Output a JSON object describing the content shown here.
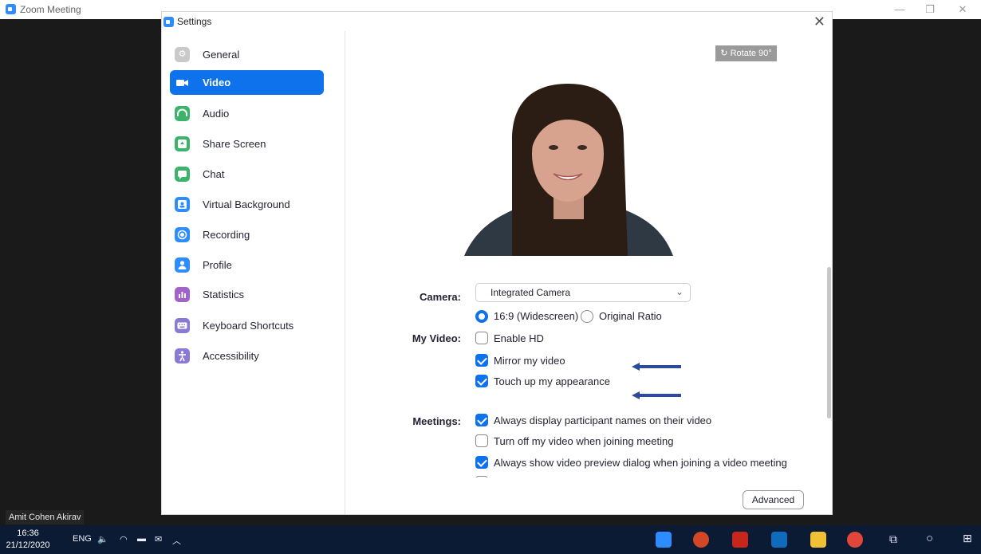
{
  "zoom_window": {
    "title": "Zoom Meeting"
  },
  "dialog": {
    "title": "Settings"
  },
  "sidebar": {
    "items": [
      {
        "label": "General",
        "icon": "gear-icon",
        "color": "#c9c9c9"
      },
      {
        "label": "Video",
        "icon": "video-camera-icon",
        "color": "#0e72ed",
        "active": true
      },
      {
        "label": "Audio",
        "icon": "headphones-icon",
        "color": "#3bb36b"
      },
      {
        "label": "Share Screen",
        "icon": "share-screen-icon",
        "color": "#3bb36b"
      },
      {
        "label": "Chat",
        "icon": "chat-icon",
        "color": "#3bb36b"
      },
      {
        "label": "Virtual Background",
        "icon": "person-background-icon",
        "color": "#2d8cff"
      },
      {
        "label": "Recording",
        "icon": "record-icon",
        "color": "#2d8cff"
      },
      {
        "label": "Profile",
        "icon": "person-icon",
        "color": "#2d8cff"
      },
      {
        "label": "Statistics",
        "icon": "bar-chart-icon",
        "color": "#a162c9"
      },
      {
        "label": "Keyboard Shortcuts",
        "icon": "keyboard-icon",
        "color": "#8a7ad4"
      },
      {
        "label": "Accessibility",
        "icon": "accessibility-icon",
        "color": "#8a7ad4"
      }
    ]
  },
  "video": {
    "rotate_label": "Rotate 90°",
    "camera_label": "Camera:",
    "camera_value": "Integrated Camera",
    "ratio_options": [
      {
        "label": "16:9 (Widescreen)",
        "selected": true
      },
      {
        "label": "Original Ratio",
        "selected": false
      }
    ],
    "my_video_label": "My Video:",
    "my_video_options": [
      {
        "label": "Enable HD",
        "checked": false
      },
      {
        "label": "Mirror my video",
        "checked": true
      },
      {
        "label": "Touch up my appearance",
        "checked": true
      }
    ],
    "meetings_label": "Meetings:",
    "meetings_options": [
      {
        "label": "Always display participant names on their video",
        "checked": true
      },
      {
        "label": "Turn off my video when joining meeting",
        "checked": false
      },
      {
        "label": "Always show video preview dialog when joining a video meeting",
        "checked": true
      }
    ],
    "advanced_label": "Advanced"
  },
  "participant": {
    "name": "Amit Cohen Akirav"
  },
  "taskbar": {
    "time": "16:36",
    "date": "21/12/2020",
    "language": "ENG"
  },
  "colors": {
    "accent": "#0e72ed",
    "taskbar": "#0b1b33"
  }
}
